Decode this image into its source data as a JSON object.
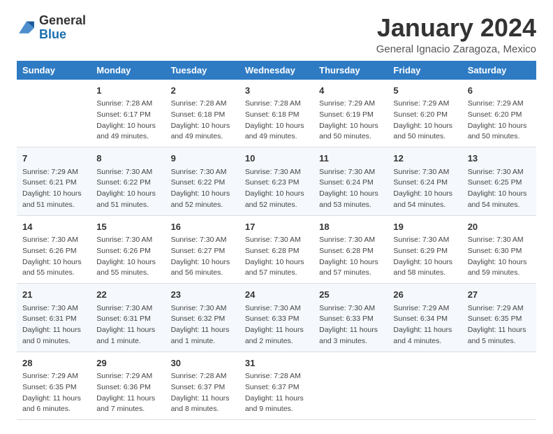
{
  "logo": {
    "general": "General",
    "blue": "Blue"
  },
  "header": {
    "month_year": "January 2024",
    "location": "General Ignacio Zaragoza, Mexico"
  },
  "weekdays": [
    "Sunday",
    "Monday",
    "Tuesday",
    "Wednesday",
    "Thursday",
    "Friday",
    "Saturday"
  ],
  "weeks": [
    [
      {
        "day": "",
        "sunrise": "",
        "sunset": "",
        "daylight": ""
      },
      {
        "day": "1",
        "sunrise": "Sunrise: 7:28 AM",
        "sunset": "Sunset: 6:17 PM",
        "daylight": "Daylight: 10 hours and 49 minutes."
      },
      {
        "day": "2",
        "sunrise": "Sunrise: 7:28 AM",
        "sunset": "Sunset: 6:18 PM",
        "daylight": "Daylight: 10 hours and 49 minutes."
      },
      {
        "day": "3",
        "sunrise": "Sunrise: 7:28 AM",
        "sunset": "Sunset: 6:18 PM",
        "daylight": "Daylight: 10 hours and 49 minutes."
      },
      {
        "day": "4",
        "sunrise": "Sunrise: 7:29 AM",
        "sunset": "Sunset: 6:19 PM",
        "daylight": "Daylight: 10 hours and 50 minutes."
      },
      {
        "day": "5",
        "sunrise": "Sunrise: 7:29 AM",
        "sunset": "Sunset: 6:20 PM",
        "daylight": "Daylight: 10 hours and 50 minutes."
      },
      {
        "day": "6",
        "sunrise": "Sunrise: 7:29 AM",
        "sunset": "Sunset: 6:20 PM",
        "daylight": "Daylight: 10 hours and 50 minutes."
      }
    ],
    [
      {
        "day": "7",
        "sunrise": "Sunrise: 7:29 AM",
        "sunset": "Sunset: 6:21 PM",
        "daylight": "Daylight: 10 hours and 51 minutes."
      },
      {
        "day": "8",
        "sunrise": "Sunrise: 7:30 AM",
        "sunset": "Sunset: 6:22 PM",
        "daylight": "Daylight: 10 hours and 51 minutes."
      },
      {
        "day": "9",
        "sunrise": "Sunrise: 7:30 AM",
        "sunset": "Sunset: 6:22 PM",
        "daylight": "Daylight: 10 hours and 52 minutes."
      },
      {
        "day": "10",
        "sunrise": "Sunrise: 7:30 AM",
        "sunset": "Sunset: 6:23 PM",
        "daylight": "Daylight: 10 hours and 52 minutes."
      },
      {
        "day": "11",
        "sunrise": "Sunrise: 7:30 AM",
        "sunset": "Sunset: 6:24 PM",
        "daylight": "Daylight: 10 hours and 53 minutes."
      },
      {
        "day": "12",
        "sunrise": "Sunrise: 7:30 AM",
        "sunset": "Sunset: 6:24 PM",
        "daylight": "Daylight: 10 hours and 54 minutes."
      },
      {
        "day": "13",
        "sunrise": "Sunrise: 7:30 AM",
        "sunset": "Sunset: 6:25 PM",
        "daylight": "Daylight: 10 hours and 54 minutes."
      }
    ],
    [
      {
        "day": "14",
        "sunrise": "Sunrise: 7:30 AM",
        "sunset": "Sunset: 6:26 PM",
        "daylight": "Daylight: 10 hours and 55 minutes."
      },
      {
        "day": "15",
        "sunrise": "Sunrise: 7:30 AM",
        "sunset": "Sunset: 6:26 PM",
        "daylight": "Daylight: 10 hours and 55 minutes."
      },
      {
        "day": "16",
        "sunrise": "Sunrise: 7:30 AM",
        "sunset": "Sunset: 6:27 PM",
        "daylight": "Daylight: 10 hours and 56 minutes."
      },
      {
        "day": "17",
        "sunrise": "Sunrise: 7:30 AM",
        "sunset": "Sunset: 6:28 PM",
        "daylight": "Daylight: 10 hours and 57 minutes."
      },
      {
        "day": "18",
        "sunrise": "Sunrise: 7:30 AM",
        "sunset": "Sunset: 6:28 PM",
        "daylight": "Daylight: 10 hours and 57 minutes."
      },
      {
        "day": "19",
        "sunrise": "Sunrise: 7:30 AM",
        "sunset": "Sunset: 6:29 PM",
        "daylight": "Daylight: 10 hours and 58 minutes."
      },
      {
        "day": "20",
        "sunrise": "Sunrise: 7:30 AM",
        "sunset": "Sunset: 6:30 PM",
        "daylight": "Daylight: 10 hours and 59 minutes."
      }
    ],
    [
      {
        "day": "21",
        "sunrise": "Sunrise: 7:30 AM",
        "sunset": "Sunset: 6:31 PM",
        "daylight": "Daylight: 11 hours and 0 minutes."
      },
      {
        "day": "22",
        "sunrise": "Sunrise: 7:30 AM",
        "sunset": "Sunset: 6:31 PM",
        "daylight": "Daylight: 11 hours and 1 minute."
      },
      {
        "day": "23",
        "sunrise": "Sunrise: 7:30 AM",
        "sunset": "Sunset: 6:32 PM",
        "daylight": "Daylight: 11 hours and 1 minute."
      },
      {
        "day": "24",
        "sunrise": "Sunrise: 7:30 AM",
        "sunset": "Sunset: 6:33 PM",
        "daylight": "Daylight: 11 hours and 2 minutes."
      },
      {
        "day": "25",
        "sunrise": "Sunrise: 7:30 AM",
        "sunset": "Sunset: 6:33 PM",
        "daylight": "Daylight: 11 hours and 3 minutes."
      },
      {
        "day": "26",
        "sunrise": "Sunrise: 7:29 AM",
        "sunset": "Sunset: 6:34 PM",
        "daylight": "Daylight: 11 hours and 4 minutes."
      },
      {
        "day": "27",
        "sunrise": "Sunrise: 7:29 AM",
        "sunset": "Sunset: 6:35 PM",
        "daylight": "Daylight: 11 hours and 5 minutes."
      }
    ],
    [
      {
        "day": "28",
        "sunrise": "Sunrise: 7:29 AM",
        "sunset": "Sunset: 6:35 PM",
        "daylight": "Daylight: 11 hours and 6 minutes."
      },
      {
        "day": "29",
        "sunrise": "Sunrise: 7:29 AM",
        "sunset": "Sunset: 6:36 PM",
        "daylight": "Daylight: 11 hours and 7 minutes."
      },
      {
        "day": "30",
        "sunrise": "Sunrise: 7:28 AM",
        "sunset": "Sunset: 6:37 PM",
        "daylight": "Daylight: 11 hours and 8 minutes."
      },
      {
        "day": "31",
        "sunrise": "Sunrise: 7:28 AM",
        "sunset": "Sunset: 6:37 PM",
        "daylight": "Daylight: 11 hours and 9 minutes."
      },
      {
        "day": "",
        "sunrise": "",
        "sunset": "",
        "daylight": ""
      },
      {
        "day": "",
        "sunrise": "",
        "sunset": "",
        "daylight": ""
      },
      {
        "day": "",
        "sunrise": "",
        "sunset": "",
        "daylight": ""
      }
    ]
  ]
}
